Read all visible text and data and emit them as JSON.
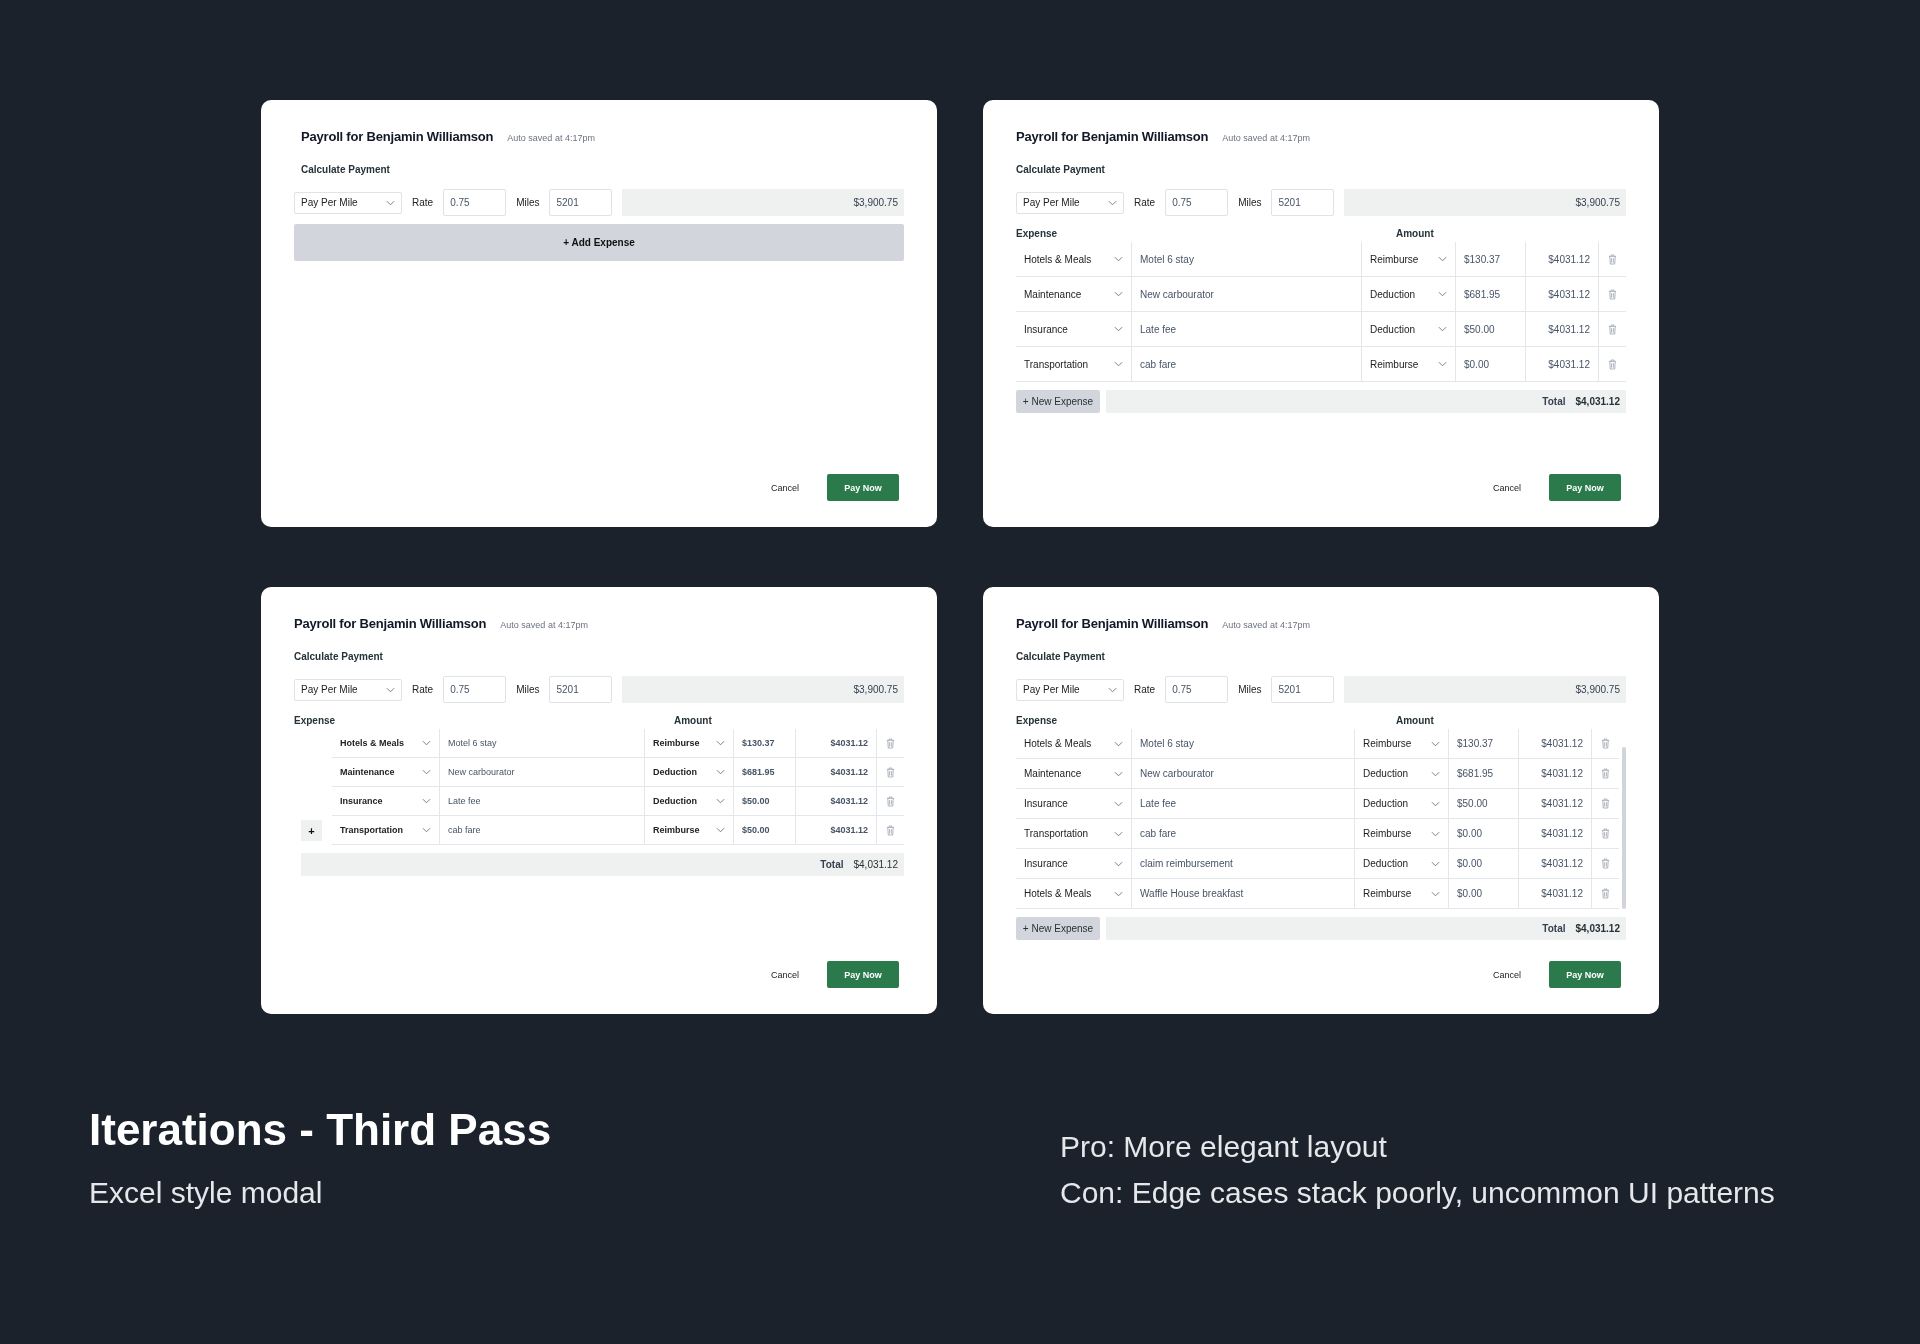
{
  "modals": [
    {
      "kind": "empty",
      "title": "Payroll for Benjamin Williamson",
      "autosave": "Auto saved at 4:17pm",
      "section": "Calculate Payment",
      "pay_type": "Pay Per Mile",
      "rate_label": "Rate",
      "rate": "0.75",
      "miles_label": "Miles",
      "miles": "5201",
      "subtotal": "$3,900.75",
      "add_button": "+ Add Expense",
      "cancel": "Cancel",
      "submit": "Pay Now"
    },
    {
      "kind": "table",
      "title": "Payroll for Benjamin Williamson",
      "autosave": "Auto saved at 4:17pm",
      "section": "Calculate Payment",
      "pay_type": "Pay Per Mile",
      "rate_label": "Rate",
      "rate": "0.75",
      "miles_label": "Miles",
      "miles": "5201",
      "subtotal": "$3,900.75",
      "expense_heading": "Expense",
      "amount_heading": "Amount",
      "rows": [
        {
          "category": "Hotels & Meals",
          "description": "Motel 6 stay",
          "type": "Reimburse",
          "amount": "$130.37",
          "total": "$4031.12"
        },
        {
          "category": "Maintenance",
          "description": "New carbourator",
          "type": "Deduction",
          "amount": "$681.95",
          "total": "$4031.12"
        },
        {
          "category": "Insurance",
          "description": "Late fee",
          "type": "Deduction",
          "amount": "$50.00",
          "total": "$4031.12"
        },
        {
          "category": "Transportation",
          "description": "cab fare",
          "type": "Reimburse",
          "amount": "$0.00",
          "total": "$4031.12"
        }
      ],
      "new_expense_button": "+ New Expense",
      "total_label": "Total",
      "total": "$4,031.12",
      "cancel": "Cancel",
      "submit": "Pay Now"
    },
    {
      "kind": "inline-add",
      "title": "Payroll for Benjamin Williamson",
      "autosave": "Auto saved at 4:17pm",
      "section": "Calculate Payment",
      "pay_type": "Pay Per Mile",
      "rate_label": "Rate",
      "rate": "0.75",
      "miles_label": "Miles",
      "miles": "5201",
      "subtotal": "$3,900.75",
      "expense_heading": "Expense",
      "amount_heading": "Amount",
      "rows": [
        {
          "category": "Hotels & Meals",
          "description": "Motel 6 stay",
          "type": "Reimburse",
          "amount": "$130.37",
          "total": "$4031.12"
        },
        {
          "category": "Maintenance",
          "description": "New carbourator",
          "type": "Deduction",
          "amount": "$681.95",
          "total": "$4031.12"
        },
        {
          "category": "Insurance",
          "description": "Late fee",
          "type": "Deduction",
          "amount": "$50.00",
          "total": "$4031.12"
        },
        {
          "category": "Transportation",
          "description": "cab fare",
          "type": "Reimburse",
          "amount": "$50.00",
          "total": "$4031.12"
        }
      ],
      "row_add_button": "+",
      "total_label": "Total",
      "total": "$4,031.12",
      "cancel": "Cancel",
      "submit": "Pay Now"
    },
    {
      "kind": "scrolling",
      "title": "Payroll for Benjamin Williamson",
      "autosave": "Auto saved at 4:17pm",
      "section": "Calculate Payment",
      "pay_type": "Pay Per Mile",
      "rate_label": "Rate",
      "rate": "0.75",
      "miles_label": "Miles",
      "miles": "5201",
      "subtotal": "$3,900.75",
      "expense_heading": "Expense",
      "amount_heading": "Amount",
      "rows": [
        {
          "category": "Hotels & Meals",
          "description": "Motel 6 stay",
          "type": "Reimburse",
          "amount": "$130.37",
          "total": "$4031.12"
        },
        {
          "category": "Maintenance",
          "description": "New carbourator",
          "type": "Deduction",
          "amount": "$681.95",
          "total": "$4031.12"
        },
        {
          "category": "Insurance",
          "description": "Late fee",
          "type": "Deduction",
          "amount": "$50.00",
          "total": "$4031.12"
        },
        {
          "category": "Transportation",
          "description": "cab fare",
          "type": "Reimburse",
          "amount": "$0.00",
          "total": "$4031.12"
        },
        {
          "category": "Insurance",
          "description": "claim reimbursement",
          "type": "Deduction",
          "amount": "$0.00",
          "total": "$4031.12"
        },
        {
          "category": "Hotels & Meals",
          "description": "Waffle House breakfast",
          "type": "Reimburse",
          "amount": "$0.00",
          "total": "$4031.12"
        }
      ],
      "new_expense_button": "+ New Expense",
      "total_label": "Total",
      "total": "$4,031.12",
      "cancel": "Cancel",
      "submit": "Pay Now"
    }
  ],
  "caption": {
    "title": "Iterations - Third Pass",
    "subtitle": "Excel style modal",
    "notes": [
      "Pro: More elegant layout",
      "Con: Edge cases stack poorly, uncommon UI patterns"
    ]
  }
}
